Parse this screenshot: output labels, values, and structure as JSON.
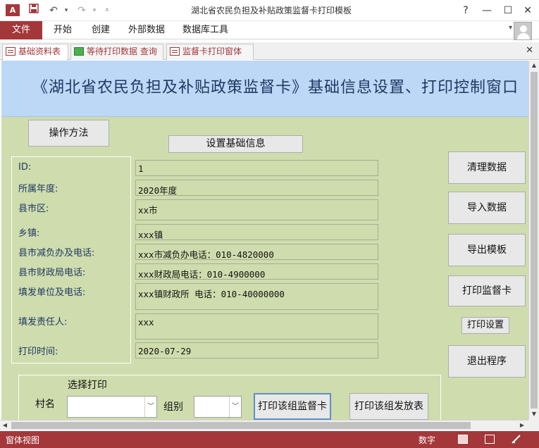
{
  "window": {
    "title": "湖北省农民负担及补贴政策监督卡打印模板",
    "app_icon": "A",
    "help": "?",
    "minimize": "—",
    "maximize": "☐",
    "close": "✕"
  },
  "quick_access": {
    "save_icon": "save-icon",
    "undo_icon": "undo-icon",
    "redo_icon": "redo-icon"
  },
  "ribbon": {
    "file": "文件",
    "tabs": [
      "开始",
      "创建",
      "外部数据",
      "数据库工具"
    ]
  },
  "doc_tabs": [
    {
      "label": "基础资料表"
    },
    {
      "label": "等待打印数据 查询"
    },
    {
      "label": "监督卡打印窗体"
    }
  ],
  "header": {
    "title": "《湖北省农民负担及补贴政策监督卡》基础信息设置、打印控制窗口"
  },
  "buttons": {
    "operation": "操作方法",
    "set_basic": "设置基础信息",
    "clear_data": "清理数据",
    "import_data": "导入数据",
    "export_template": "导出模板",
    "print_card": "打印监督卡",
    "print_setup": "打印设置",
    "exit": "退出程序",
    "print_group_card": "打印该组监督卡",
    "print_group_table": "打印该组发放表"
  },
  "fields": [
    {
      "label": "ID:",
      "value": "1"
    },
    {
      "label": "所属年度:",
      "value": "2020年度"
    },
    {
      "label": "县市区:",
      "value": "xx市"
    },
    {
      "label": "乡镇:",
      "value": "xxx镇"
    },
    {
      "label": "县市减负办及电话:",
      "value": "xxx市减负办电话：010-4820000"
    },
    {
      "label": "县市财政局电话:",
      "value": "xxx财政局电话：010-4900000"
    },
    {
      "label": "填发单位及电话:",
      "value": "xxx镇财政所   电话：010-40000000"
    },
    {
      "label": "填发责任人:",
      "value": "xxx"
    },
    {
      "label": "打印时间:",
      "value": "2020-07-29"
    }
  ],
  "print_group": {
    "title": "选择打印",
    "village_label": "村名",
    "village_value": "",
    "group_label": "组别",
    "group_value": ""
  },
  "status": {
    "left": "窗体视图",
    "num": "数字"
  }
}
